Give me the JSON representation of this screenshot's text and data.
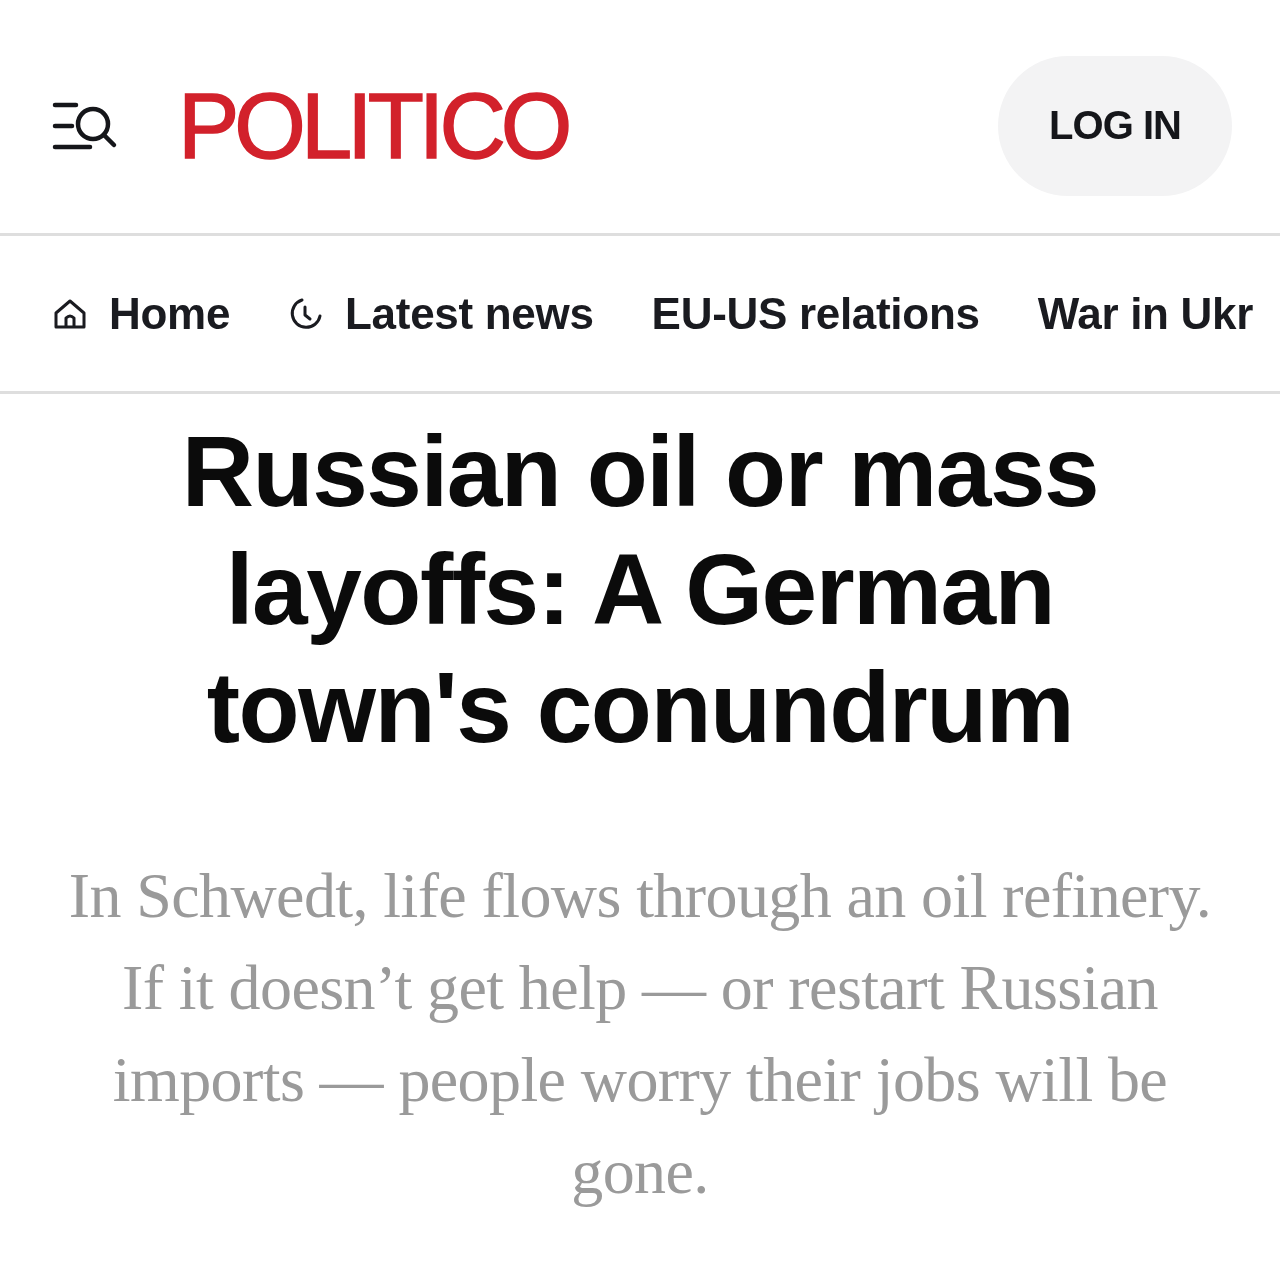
{
  "header": {
    "logo": "POLITICO",
    "login_button": "LOG IN"
  },
  "nav": {
    "items": [
      {
        "label": "Home",
        "kind": "home"
      },
      {
        "label": "Latest news",
        "kind": "clock"
      },
      {
        "label": "EU-US relations",
        "kind": "plain"
      },
      {
        "label": "War in Ukr",
        "kind": "plain"
      }
    ]
  },
  "article": {
    "headline": "Russian oil or mass layoffs: A German town's conundrum",
    "dek": "In Schwedt, life flows through an oil refinery. If it doesn’t get help — or restart Russian imports — people worry their jobs will be gone."
  }
}
